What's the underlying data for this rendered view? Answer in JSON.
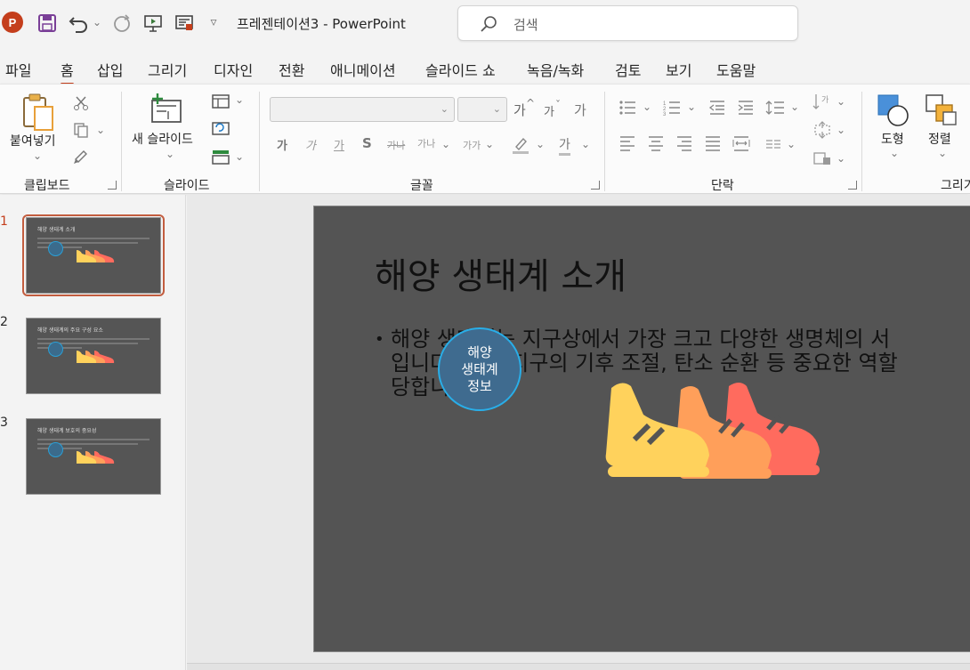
{
  "app": {
    "doc_title": "프레젠테이션3  -  PowerPoint",
    "search_placeholder": "검색",
    "logo_letter": "P"
  },
  "tabs": [
    {
      "label": "파일",
      "active": false
    },
    {
      "label": "홈",
      "active": true
    },
    {
      "label": "삽입",
      "active": false
    },
    {
      "label": "그리기",
      "active": false
    },
    {
      "label": "디자인",
      "active": false
    },
    {
      "label": "전환",
      "active": false
    },
    {
      "label": "애니메이션",
      "active": false
    },
    {
      "label": "슬라이드 쇼",
      "active": false
    },
    {
      "label": "녹음/녹화",
      "active": false
    },
    {
      "label": "검토",
      "active": false
    },
    {
      "label": "보기",
      "active": false
    },
    {
      "label": "도움말",
      "active": false
    }
  ],
  "ribbon": {
    "clipboard": {
      "paste_label": "붙여넣기",
      "group_label": "클립보드"
    },
    "slides": {
      "new_slide_label": "새 슬라이드",
      "group_label": "슬라이드"
    },
    "font": {
      "group_label": "글꼴",
      "increase_size": "가",
      "decrease_size": "가",
      "clear_format": "가",
      "bold": "가",
      "italic": "가",
      "underline": "가",
      "shadow": "S",
      "strike": "가나",
      "spacing": "가나",
      "case": "가가",
      "highlight": "가"
    },
    "paragraph": {
      "group_label": "단락"
    },
    "drawing": {
      "shapes_label": "도형",
      "arrange_label": "정렬",
      "group_label": "그리기"
    }
  },
  "thumbnails": [
    {
      "number": "1",
      "title": "해양 생태계 소개",
      "active": true
    },
    {
      "number": "2",
      "title": "해양 생태계의 주요 구성 요소",
      "active": false
    },
    {
      "number": "3",
      "title": "해양 생태계 보호의 중요성",
      "active": false
    }
  ],
  "slide": {
    "title": "해양 생태계 소개",
    "body_line1": "해양 생태계는 지구상에서 가장 크고 다양한 생명체의 서",
    "body_line2": "입니다. 이는 지구의 기후 조절, 탄소 순환 등 중요한 역할",
    "body_line3": "당합니다.",
    "badge_line1": "해양",
    "badge_line2": "생태계",
    "badge_line3": "정보"
  },
  "colors": {
    "accent": "#c43e1c",
    "slide_bg": "#545454",
    "shoe_yellow": "#ffd25c",
    "shoe_orange": "#ff9f5a",
    "shoe_red": "#ff6b5e",
    "badge_fill": "#3f6b8f",
    "badge_ring": "#29aee8"
  }
}
